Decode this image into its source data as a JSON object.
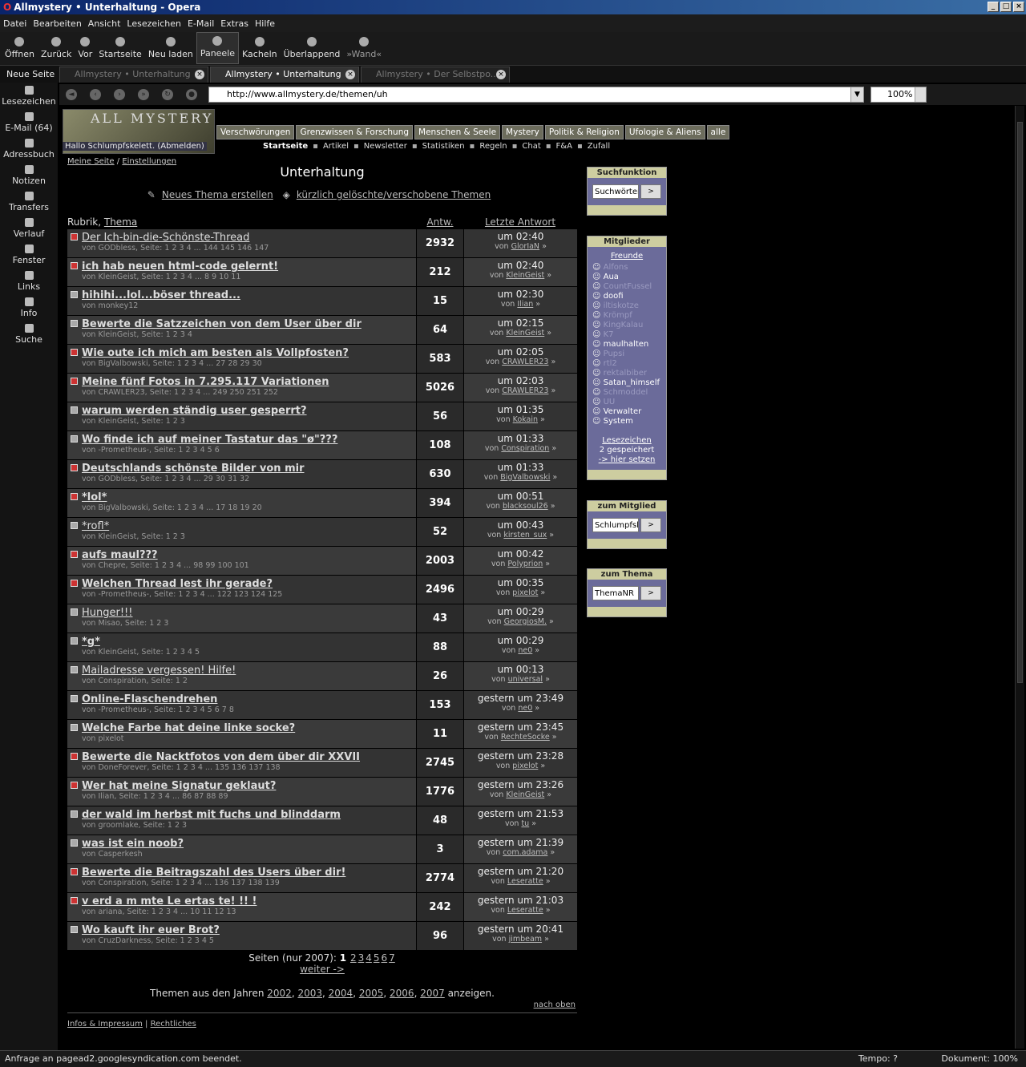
{
  "window": {
    "title": "Allmystery • Unterhaltung - Opera"
  },
  "menu": [
    "Datei",
    "Bearbeiten",
    "Ansicht",
    "Lesezeichen",
    "E-Mail",
    "Extras",
    "Hilfe"
  ],
  "toolbar": [
    {
      "label": "Öffnen"
    },
    {
      "label": "Zurück"
    },
    {
      "label": "Vor"
    },
    {
      "label": "Startseite"
    },
    {
      "label": "Neu laden"
    },
    {
      "label": "Paneele"
    },
    {
      "label": "Kacheln"
    },
    {
      "label": "Überlappend"
    },
    {
      "label": "»Wand«"
    }
  ],
  "tabs": {
    "new_page": "Neue Seite",
    "items": [
      {
        "label": "Allmystery • Unterhaltung"
      },
      {
        "label": "Allmystery • Unterhaltung"
      },
      {
        "label": "Allmystery • Der Selbstpo..."
      }
    ]
  },
  "sidebar": [
    "Lesezeichen",
    "E-Mail (64)",
    "Adressbuch",
    "Notizen",
    "Transfers",
    "Verlauf",
    "Fenster",
    "Links",
    "Info",
    "Suche"
  ],
  "address": {
    "url": "http://www.allmystery.de/themen/uh",
    "zoom": "100%"
  },
  "site": {
    "logo": "ALL MYSTERY",
    "categories": [
      "Verschwörungen",
      "Grenzwissen & Forschung",
      "Menschen & Seele",
      "Mystery",
      "Politik & Religion",
      "Ufologie & Aliens",
      "alle"
    ],
    "hello": "Hallo Schlumpfskelett. (Abmelden)",
    "topnav": [
      "Startseite",
      "Artikel",
      "Newsletter",
      "Statistiken",
      "Regeln",
      "Chat",
      "F&A",
      "Zufall"
    ]
  },
  "main": {
    "crumb_1": "Meine Seite",
    "crumb_sep": " / ",
    "crumb_2": "Einstellungen",
    "title": "Unterhaltung",
    "action_new": "Neues Thema erstellen",
    "action_deleted": "kürzlich gelöschte/verschobene Themen",
    "col_rubrik": "Rubrik, ",
    "col_thema": "Thema",
    "col_antw": "Antw.",
    "col_last": "Letzte Antwort",
    "threads": [
      {
        "title": "Der Ich-bin-die-Schönste-Thread",
        "meta": "von GODbless, Seite: 1 2 3 4 ... 144 145 146 147",
        "count": "2932",
        "time": "um 02:40",
        "by": "GlorIaN",
        "hot": true,
        "bold": false
      },
      {
        "title": " ich hab neuen html-code gelernt!",
        "meta": "von KleinGeist, Seite: 1 2 3 4 ... 8 9 10 11",
        "count": "212",
        "time": "um 02:40",
        "by": "KleinGeist",
        "hot": true,
        "bold": true
      },
      {
        "title": "hihihi...lol...böser thread...",
        "meta": "von monkey12",
        "count": "15",
        "time": "um 02:30",
        "by": "Ilian",
        "hot": false,
        "bold": true
      },
      {
        "title": "Bewerte die Satzzeichen von dem User über dir",
        "meta": "von KleinGeist, Seite: 1 2 3 4",
        "count": "64",
        "time": "um 02:15",
        "by": "KleinGeist",
        "hot": false,
        "bold": true
      },
      {
        "title": "Wie oute ich mich am besten als Vollpfosten? ",
        "meta": "von BigValbowski, Seite: 1 2 3 4 ... 27 28 29 30",
        "count": "583",
        "time": "um 02:05",
        "by": "CRAWLER23",
        "hot": true,
        "bold": true
      },
      {
        "title": "Meine fünf Fotos in 7.295.117 Variationen",
        "meta": "von CRAWLER23, Seite: 1 2 3 4 ... 249 250 251 252",
        "count": "5026",
        "time": "um 02:03",
        "by": "CRAWLER23",
        "hot": true,
        "bold": true
      },
      {
        "title": "warum werden ständig user gesperrt?",
        "meta": "von KleinGeist, Seite: 1 2 3",
        "count": "56",
        "time": "um 01:35",
        "by": "Kokain",
        "hot": false,
        "bold": true
      },
      {
        "title": " Wo finde ich auf meiner Tastatur das \"ø\"???",
        "meta": "von -Prometheus-, Seite: 1 2 3 4 5 6",
        "count": "108",
        "time": "um 01:33",
        "by": "Conspiration",
        "hot": false,
        "bold": true
      },
      {
        "title": "Deutschlands schönste Bilder von mir ",
        "meta": "von GODbless, Seite: 1 2 3 4 ... 29 30 31 32",
        "count": "630",
        "time": "um 01:33",
        "by": "BigValbowski",
        "hot": true,
        "bold": true
      },
      {
        "title": "*lol*",
        "meta": "von BigValbowski, Seite: 1 2 3 4 ... 17 18 19 20",
        "count": "394",
        "time": "um 00:51",
        "by": "blacksoul26",
        "hot": true,
        "bold": true
      },
      {
        "title": "*rofl*",
        "meta": "von KleinGeist, Seite: 1 2 3",
        "count": "52",
        "time": "um 00:43",
        "by": "kirsten_sux",
        "hot": false,
        "bold": false
      },
      {
        "title": "aufs maul???",
        "meta": "von Chepre, Seite: 1 2 3 4 ... 98 99 100 101",
        "count": "2003",
        "time": "um 00:42",
        "by": "Polyprion",
        "hot": true,
        "bold": true
      },
      {
        "title": "Welchen Thread lest ihr gerade?",
        "meta": "von -Prometheus-, Seite: 1 2 3 4 ... 122 123 124 125",
        "count": "2496",
        "time": "um 00:35",
        "by": "pixelot",
        "hot": true,
        "bold": true
      },
      {
        "title": "Hunger!!!",
        "meta": "von Misao, Seite: 1 2 3",
        "count": "43",
        "time": "um 00:29",
        "by": "GeorgiosM.",
        "hot": false,
        "bold": false
      },
      {
        "title": "*g*",
        "meta": "von KleinGeist, Seite: 1 2 3 4 5",
        "count": "88",
        "time": "um 00:29",
        "by": "ne0",
        "hot": false,
        "bold": true
      },
      {
        "title": "Mailadresse vergessen! Hilfe!",
        "meta": "von Conspiration, Seite: 1 2",
        "count": "26",
        "time": "um 00:13",
        "by": "universal",
        "hot": false,
        "bold": false
      },
      {
        "title": "Online-Flaschendrehen",
        "meta": "von -Prometheus-, Seite: 1 2 3 4 5 6 7 8",
        "count": "153",
        "time": "gestern um 23:49",
        "by": "ne0",
        "hot": false,
        "bold": true
      },
      {
        "title": "Welche Farbe hat deine linke socke?",
        "meta": "von pixelot",
        "count": "11",
        "time": "gestern um 23:45",
        "by": "RechteSocke",
        "hot": false,
        "bold": true
      },
      {
        "title": "Bewerte die Nacktfotos von dem über dir XXVII",
        "meta": "von DoneForever, Seite: 1 2 3 4 ... 135 136 137 138",
        "count": "2745",
        "time": "gestern um 23:28",
        "by": "pixelot",
        "hot": true,
        "bold": true
      },
      {
        "title": "Wer hat meine Signatur geklaut?",
        "meta": "von Ilian, Seite: 1 2 3 4 ... 86 87 88 89",
        "count": "1776",
        "time": "gestern um 23:26",
        "by": "KleinGeist",
        "hot": true,
        "bold": true
      },
      {
        "title": "der wald im herbst mit fuchs und blinddarm",
        "meta": "von groomlake, Seite: 1 2 3",
        "count": "48",
        "time": "gestern um 21:53",
        "by": "tu",
        "hot": false,
        "bold": true
      },
      {
        "title": "was ist ein noob?",
        "meta": "von Casperkesh",
        "count": "3",
        "time": "gestern um 21:39",
        "by": "com.adama",
        "hot": false,
        "bold": true
      },
      {
        "title": "Bewerte die Beitragszahl des Users über dir!",
        "meta": "von Conspiration, Seite: 1 2 3 4 ... 136 137 138 139",
        "count": "2774",
        "time": "gestern um 21:20",
        "by": "Leseratte",
        "hot": true,
        "bold": true
      },
      {
        "title": "v erd a m mte Le ertas te! !! !",
        "meta": "von ariana, Seite: 1 2 3 4 ... 10 11 12 13",
        "count": "242",
        "time": "gestern um 21:03",
        "by": "Leseratte",
        "hot": true,
        "bold": true
      },
      {
        "title": "Wo kauft ihr euer Brot?",
        "meta": "von CruzDarkness, Seite: 1 2 3 4 5",
        "count": "96",
        "time": "gestern um 20:41",
        "by": "jimbeam",
        "hot": false,
        "bold": true
      }
    ],
    "pages_label": "Seiten (nur 2007): ",
    "pages_current": "1",
    "pages": [
      "2",
      "3",
      "4",
      "5",
      "6",
      "7"
    ],
    "next": "weiter ->",
    "years_prefix": "Themen aus den Jahren ",
    "years": [
      "2002",
      "2003",
      "2004",
      "2005",
      "2006",
      "2007"
    ],
    "years_suffix": " anzeigen.",
    "to_top": "nach oben",
    "footer_1": "Infos & Impressum",
    "footer_sep": " | ",
    "footer_2": "Rechtliches"
  },
  "boxes": {
    "search": {
      "title": "Suchfunktion",
      "placeholder": "Suchwörter",
      "button": ">"
    },
    "members": {
      "title": "Mitglieder",
      "friends": "Freunde",
      "list": [
        {
          "name": "Alfons",
          "online": false
        },
        {
          "name": "Aua",
          "online": true
        },
        {
          "name": "CountFussel",
          "online": false
        },
        {
          "name": "doofi",
          "online": true
        },
        {
          "name": "iltiskotze",
          "online": false
        },
        {
          "name": "Krömpf",
          "online": false
        },
        {
          "name": "KingKalau",
          "online": false
        },
        {
          "name": "K7",
          "online": false
        },
        {
          "name": "maulhalten",
          "online": true
        },
        {
          "name": "Pupsi",
          "online": false
        },
        {
          "name": "rtl2",
          "online": false
        },
        {
          "name": "rektalbiber",
          "online": false
        },
        {
          "name": "Satan_himself",
          "online": true
        },
        {
          "name": "Schmoddel",
          "online": false
        },
        {
          "name": "UU",
          "online": false
        },
        {
          "name": "Verwalter",
          "online": true
        },
        {
          "name": "System",
          "online": true
        }
      ],
      "bookmarks": "Lesezeichen",
      "saved": "2 gespeichert",
      "set_here": "-> hier setzen"
    },
    "to_member": {
      "title": "zum Mitglied",
      "placeholder": "Schlumpfsk",
      "button": ">"
    },
    "to_thread": {
      "title": "zum Thema",
      "placeholder": "ThemaNR",
      "button": ">"
    }
  },
  "status": {
    "left": "Anfrage an pagead2.googlesyndication.com beendet.",
    "tempo": "Tempo:  ?",
    "doc": "Dokument:  100%"
  }
}
